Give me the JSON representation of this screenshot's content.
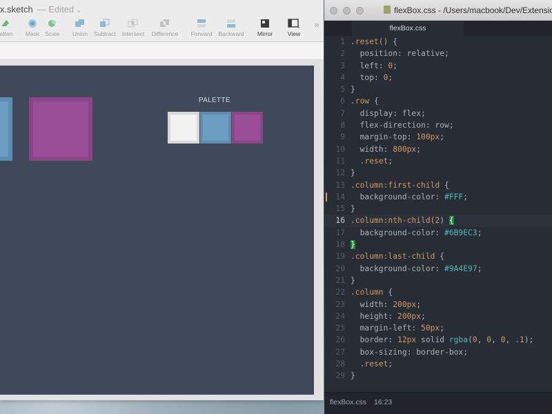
{
  "sketch": {
    "title": "x.sketch",
    "edited": "— Edited",
    "tools": [
      {
        "label": "atten",
        "icon": "flatten-icon"
      },
      {
        "label": "Mask",
        "icon": "mask-icon"
      },
      {
        "label": "Scale",
        "icon": "scale-icon"
      },
      {
        "label": "Union",
        "icon": "union-icon"
      },
      {
        "label": "Subtract",
        "icon": "subtract-icon"
      },
      {
        "label": "Intersect",
        "icon": "intersect-icon"
      },
      {
        "label": "Difference",
        "icon": "difference-icon"
      },
      {
        "label": "Forward",
        "icon": "forward-icon"
      },
      {
        "label": "Backward",
        "icon": "backward-icon"
      },
      {
        "label": "Mirror",
        "icon": "mirror-icon"
      },
      {
        "label": "View",
        "icon": "view-icon"
      }
    ],
    "overflow_icon": "overflow-chevron-icon",
    "palette_title": "PALETTE",
    "colors": {
      "white": "#F2F2F2",
      "blue": "#6B9EC3",
      "purple": "#9A4E97",
      "artboard": "#3F4959"
    }
  },
  "editor": {
    "window_title": "flexBox.css - /Users/macbook/Dev/Extensions",
    "tab_label": "flexBox.css",
    "current_line": 16,
    "lines": [
      {
        "n": "1",
        "code": ".reset() {"
      },
      {
        "n": "2",
        "code": "  position: relative;"
      },
      {
        "n": "3",
        "code": "  left: 0;"
      },
      {
        "n": "4",
        "code": "  top: 0;"
      },
      {
        "n": "5",
        "code": "}"
      },
      {
        "n": "6",
        "code": ".row {"
      },
      {
        "n": "7",
        "code": "  display: flex;"
      },
      {
        "n": "8",
        "code": "  flex-direction: row;"
      },
      {
        "n": "9",
        "code": "  margin-top: 100px;"
      },
      {
        "n": "10",
        "code": "  width: 800px;"
      },
      {
        "n": "11",
        "code": "  .reset;"
      },
      {
        "n": "12",
        "code": "}"
      },
      {
        "n": "13",
        "code": ".column:first-child {"
      },
      {
        "n": "14",
        "code": "  background-color: #FFF;"
      },
      {
        "n": "15",
        "code": "}"
      },
      {
        "n": "16",
        "code": ".column:nth-child(2) {"
      },
      {
        "n": "17",
        "code": "  background-color: #6B9EC3;"
      },
      {
        "n": "18",
        "code": "}"
      },
      {
        "n": "19",
        "code": ".column:last-child {"
      },
      {
        "n": "20",
        "code": "  background-color: #9A4E97;"
      },
      {
        "n": "21",
        "code": "}"
      },
      {
        "n": "22",
        "code": ".column {"
      },
      {
        "n": "23",
        "code": "  width: 200px;"
      },
      {
        "n": "24",
        "code": "  height: 200px;"
      },
      {
        "n": "25",
        "code": "  margin-left: 50px;"
      },
      {
        "n": "26",
        "code": "  border: 12px solid rgba(0, 0, 0, .1);"
      },
      {
        "n": "27",
        "code": "  box-sizing: border-box;"
      },
      {
        "n": "28",
        "code": "  .reset;"
      },
      {
        "n": "29",
        "code": "}"
      }
    ],
    "status": {
      "file": "flexBox.css",
      "cursor": "16:23"
    }
  }
}
